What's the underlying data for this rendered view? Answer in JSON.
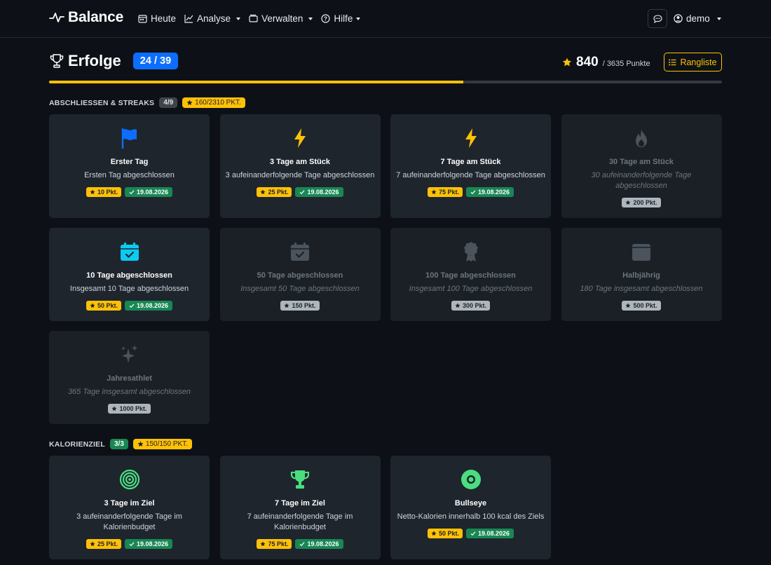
{
  "navbar": {
    "brand": "Balance",
    "items": [
      {
        "label": "Heute",
        "icon": "calendar-icon",
        "dropdown": false
      },
      {
        "label": "Analyse",
        "icon": "chart-line-icon",
        "dropdown": true
      },
      {
        "label": "Verwalten",
        "icon": "wallet-icon",
        "dropdown": true
      },
      {
        "label": "Hilfe",
        "icon": "question-circle-icon",
        "dropdown": true
      }
    ],
    "user": "demo"
  },
  "header": {
    "title": "Erfolge",
    "unlocked_count": "24 / 39",
    "points": "840",
    "points_total": "/ 3635 Punkte",
    "ranking_label": "Rangliste",
    "progress_fraction": 0.6154
  },
  "colors": {
    "accent_yellow": "#ffc107",
    "primary_blue": "#0d6efd",
    "success_green": "#198754",
    "icon_green": "#4ade80",
    "icon_cyan": "#0dcaf0"
  },
  "sections": [
    {
      "title": "ABSCHLIESSEN & STREAKS",
      "count": "4/9",
      "points": "160/2310 PKT.",
      "cards": [
        {
          "name": "Erster Tag",
          "desc": "Ersten Tag abgeschlossen",
          "points": "10 Pkt.",
          "date": "19.08.2026",
          "icon": "flag-icon",
          "unlocked": true
        },
        {
          "name": "3 Tage am Stück",
          "desc": "3 aufeinanderfolgende Tage abgeschlossen",
          "points": "25 Pkt.",
          "date": "19.08.2026",
          "icon": "lightning-icon",
          "unlocked": true
        },
        {
          "name": "7 Tage am Stück",
          "desc": "7 aufeinanderfolgende Tage abgeschlossen",
          "points": "75 Pkt.",
          "date": "19.08.2026",
          "icon": "lightning-icon",
          "unlocked": true
        },
        {
          "name": "30 Tage am Stück",
          "desc": "30 aufeinanderfolgende Tage abgeschlossen",
          "points": "200 Pkt.",
          "icon": "fire-icon",
          "unlocked": false
        },
        {
          "name": "10 Tage abgeschlossen",
          "desc": "Insgesamt 10 Tage abgeschlossen",
          "points": "50 Pkt.",
          "date": "19.08.2026",
          "icon": "calendar-check-icon",
          "unlocked": true
        },
        {
          "name": "50 Tage abgeschlossen",
          "desc": "Insgesamt 50 Tage abgeschlossen",
          "points": "150 Pkt.",
          "icon": "calendar-check-icon",
          "unlocked": false
        },
        {
          "name": "100 Tage abgeschlossen",
          "desc": "Insgesamt 100 Tage abgeschlossen",
          "points": "300 Pkt.",
          "icon": "award-icon",
          "unlocked": false
        },
        {
          "name": "Halbjährig",
          "desc": "180 Tage insgesamt abgeschlossen",
          "points": "500 Pkt.",
          "icon": "calendar-icon",
          "unlocked": false
        },
        {
          "name": "Jahresathlet",
          "desc": "365 Tage insgesamt abgeschlossen",
          "points": "1000 Pkt.",
          "icon": "sparkles-icon",
          "unlocked": false
        }
      ]
    },
    {
      "title": "KALORIENZIEL",
      "count": "3/3",
      "points": "150/150 PKT.",
      "cards": [
        {
          "name": "3 Tage im Ziel",
          "desc": "3 aufeinanderfolgende Tage im Kalorienbudget",
          "points": "25 Pkt.",
          "date": "19.08.2026",
          "icon": "target-icon",
          "unlocked": true
        },
        {
          "name": "7 Tage im Ziel",
          "desc": "7 aufeinanderfolgende Tage im Kalorienbudget",
          "points": "75 Pkt.",
          "date": "19.08.2026",
          "icon": "trophy-icon",
          "unlocked": true
        },
        {
          "name": "Bullseye",
          "desc": "Netto-Kalorien innerhalb 100 kcal des Ziels",
          "points": "50 Pkt.",
          "date": "19.08.2026",
          "icon": "bullseye-icon",
          "unlocked": true
        }
      ]
    }
  ]
}
